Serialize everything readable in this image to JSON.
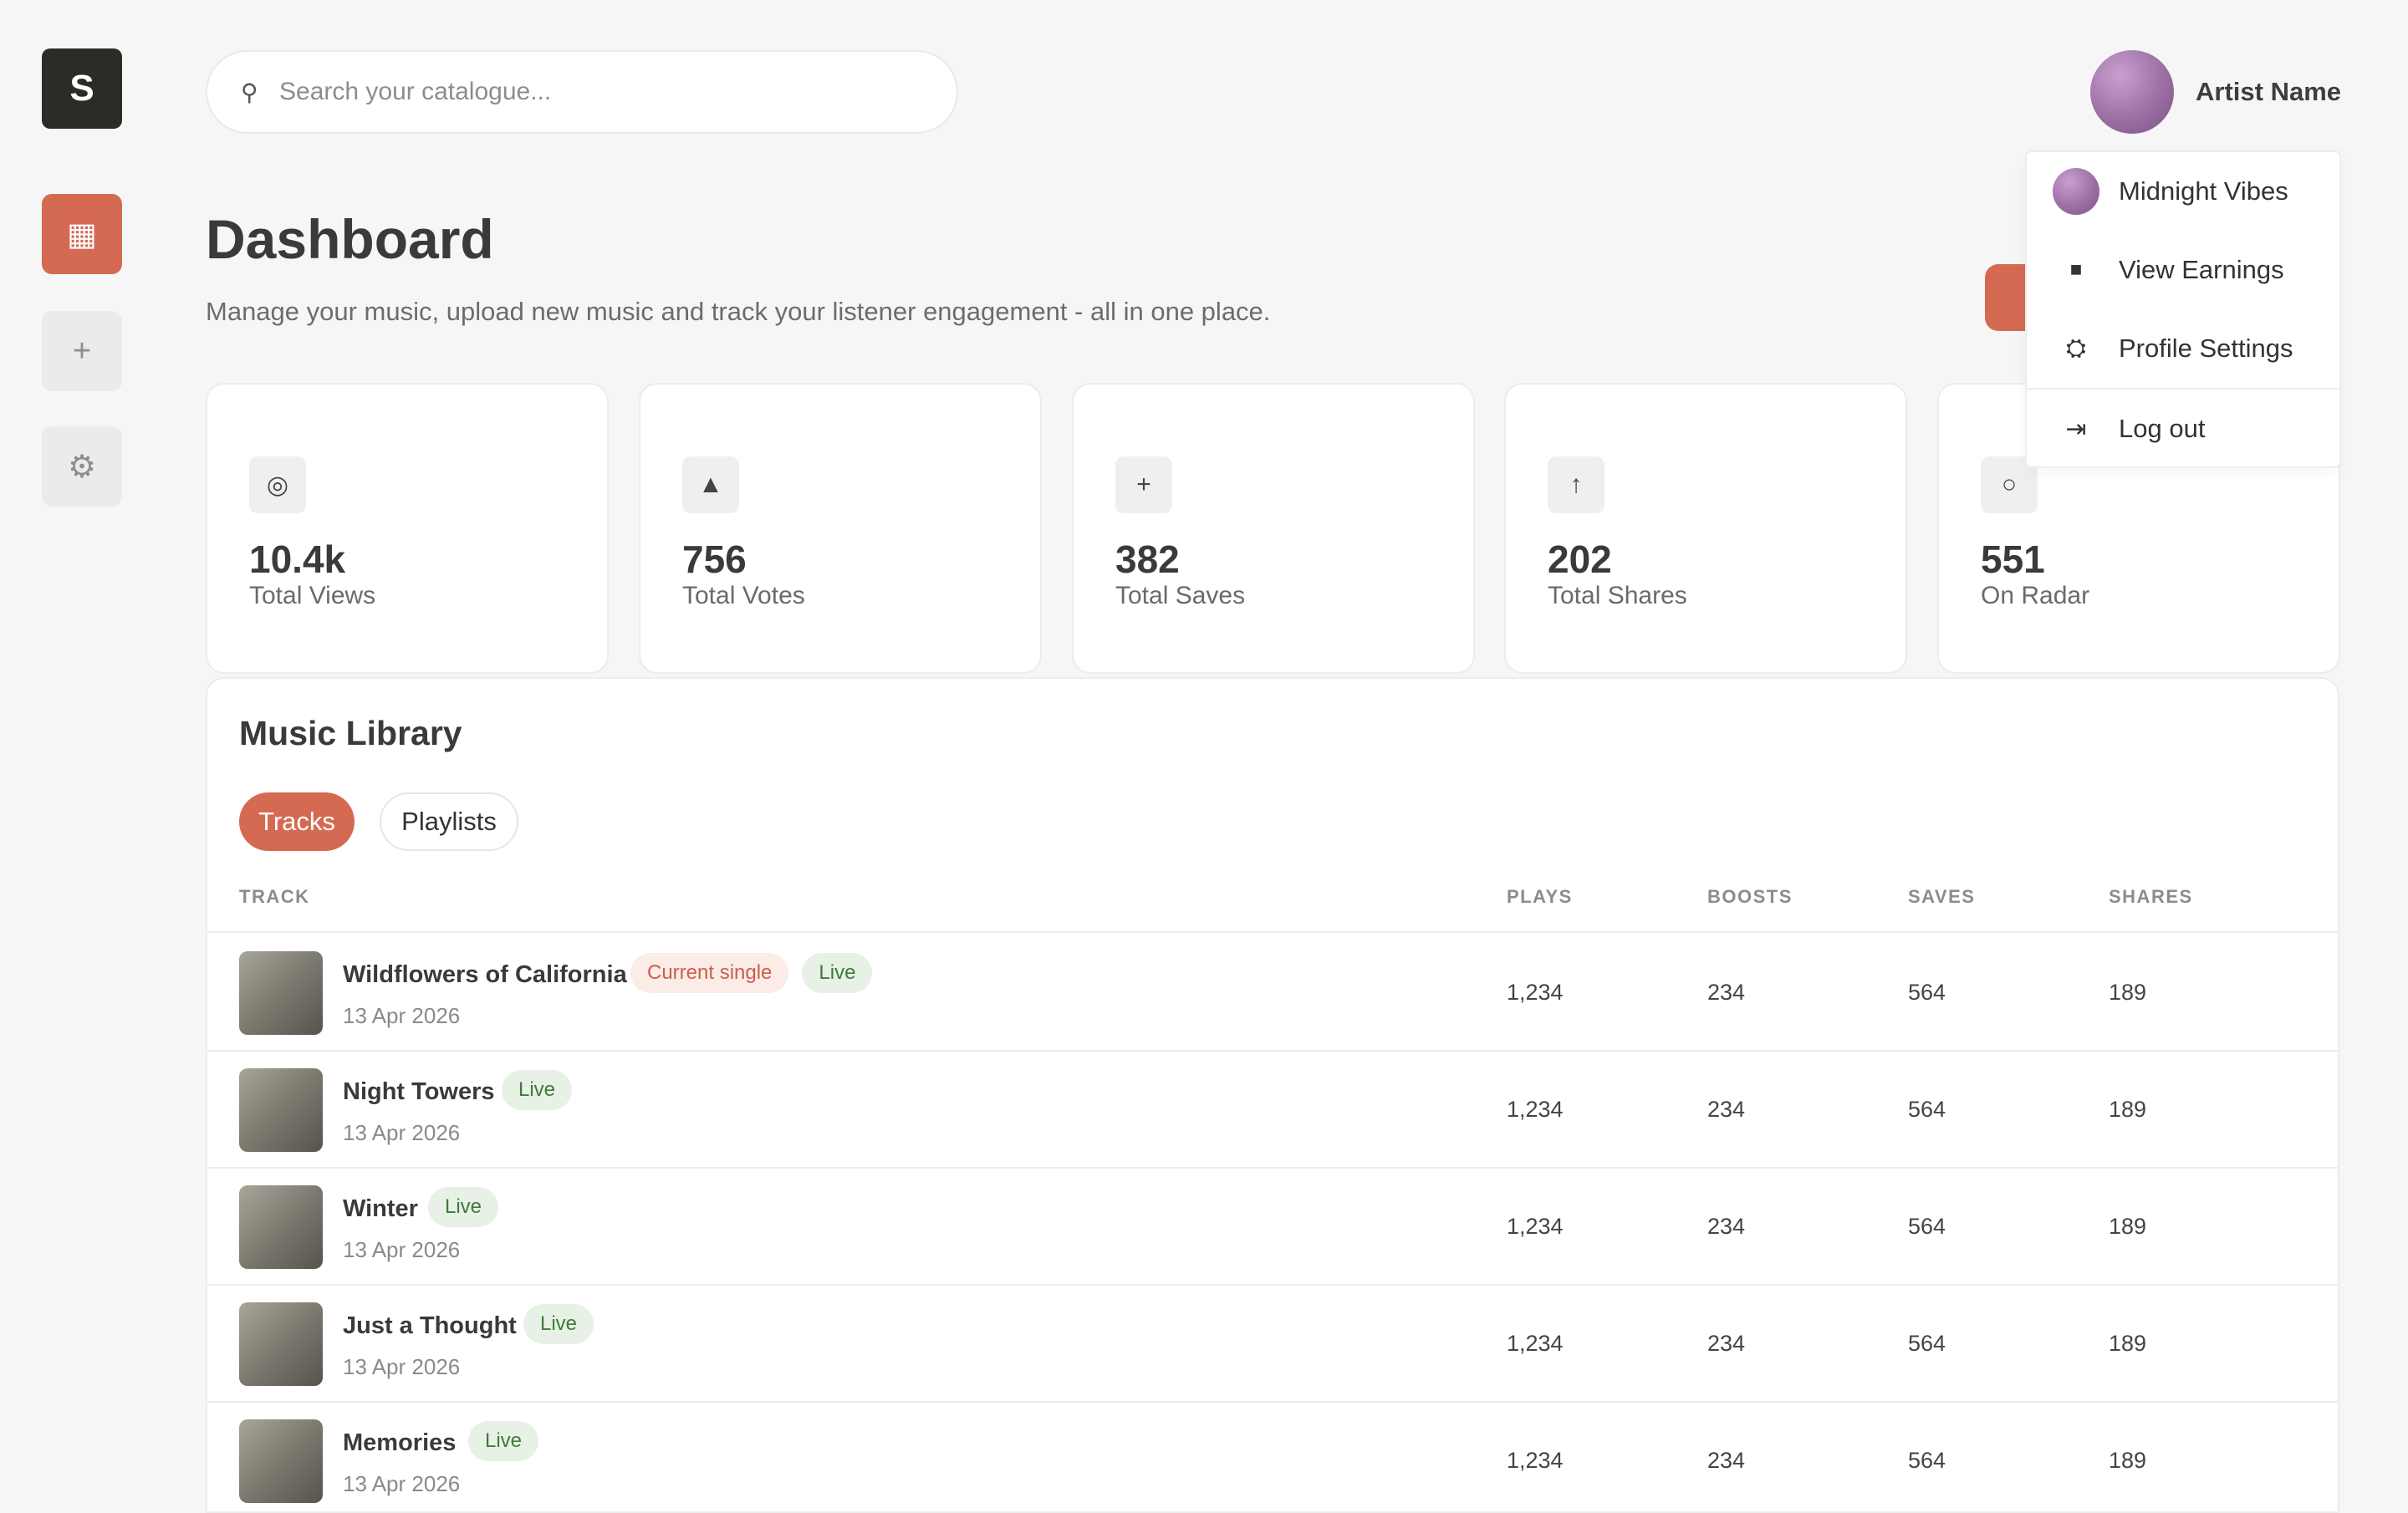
{
  "brand": {
    "logo_letter": "S"
  },
  "sidebar": {
    "items": [
      {
        "name": "dashboard",
        "icon": "grid-icon",
        "glyph": "▦"
      },
      {
        "name": "add",
        "icon": "plus-icon",
        "glyph": "+"
      },
      {
        "name": "settings",
        "icon": "gear-icon",
        "glyph": "⚙"
      }
    ]
  },
  "search": {
    "placeholder": "Search your catalogue...",
    "icon": "search-icon",
    "glyph": "⚲"
  },
  "profile": {
    "name": "Artist Name"
  },
  "page": {
    "title": "Dashboard",
    "subtitle": "Manage your music, upload new music and track your listener engagement - all in one place."
  },
  "stats": [
    {
      "icon": "eye-icon",
      "glyph": "◎",
      "value": "10.4k",
      "label": "Total Views"
    },
    {
      "icon": "triangle-up-icon",
      "glyph": "▲",
      "value": "756",
      "label": "Total Votes"
    },
    {
      "icon": "plus-icon",
      "glyph": "+",
      "value": "382",
      "label": "Total Saves"
    },
    {
      "icon": "arrow-up-icon",
      "glyph": "↑",
      "value": "202",
      "label": "Total Shares"
    },
    {
      "icon": "radar-icon",
      "glyph": "○",
      "value": "551",
      "label": "On Radar"
    }
  ],
  "library": {
    "title": "Music Library",
    "tabs": [
      {
        "label": "Tracks",
        "active": true
      },
      {
        "label": "Playlists",
        "active": false
      }
    ],
    "columns": {
      "track": "TRACK",
      "plays": "PLAYS",
      "boosts": "BOOSTS",
      "saves": "SAVES",
      "shares": "SHARES"
    },
    "rows": [
      {
        "title": "Wildflowers of California",
        "date": "13 Apr 2026",
        "badges": [
          "Current single",
          "Live"
        ],
        "plays": "1,234",
        "boosts": "234",
        "saves": "564",
        "shares": "189"
      },
      {
        "title": "Night Towers",
        "date": "13 Apr 2026",
        "badges": [
          "Live"
        ],
        "plays": "1,234",
        "boosts": "234",
        "saves": "564",
        "shares": "189"
      },
      {
        "title": "Winter",
        "date": "13 Apr 2026",
        "badges": [
          "Live"
        ],
        "plays": "1,234",
        "boosts": "234",
        "saves": "564",
        "shares": "189"
      },
      {
        "title": "Just a Thought",
        "date": "13 Apr 2026",
        "badges": [
          "Live"
        ],
        "plays": "1,234",
        "boosts": "234",
        "saves": "564",
        "shares": "189"
      },
      {
        "title": "Memories",
        "date": "13 Apr 2026",
        "badges": [
          "Live"
        ],
        "plays": "1,234",
        "boosts": "234",
        "saves": "564",
        "shares": "189"
      }
    ]
  },
  "menu": {
    "items": [
      {
        "label": "Midnight Vibes",
        "icon": "avatar"
      },
      {
        "label": "View Earnings",
        "icon": "square-icon",
        "glyph": "■"
      },
      {
        "label": "Profile Settings",
        "icon": "cog-icon",
        "glyph": "⛭"
      },
      {
        "label": "Log out",
        "icon": "logout-icon",
        "glyph": "⇥"
      }
    ]
  },
  "colors": {
    "accent": "#d56a53",
    "live_bg": "#e7f1e5",
    "live_text": "#3f7a3a",
    "single_bg": "#fbece8",
    "single_text": "#c9604a"
  }
}
